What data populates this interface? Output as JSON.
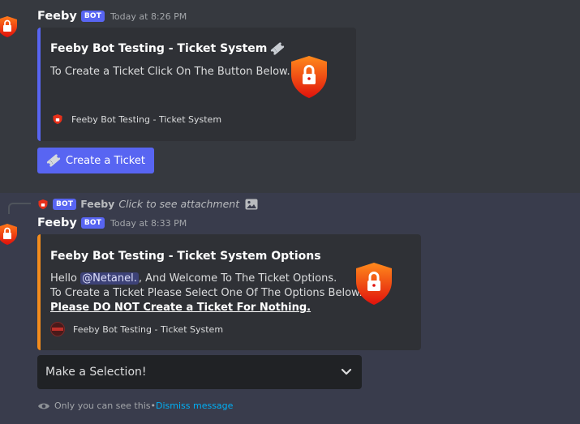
{
  "message1": {
    "username": "Feeby",
    "bot_tag": "BOT",
    "timestamp": "Today at 8:26 PM",
    "embed": {
      "accent_color": "#5865f2",
      "title": "Feeby Bot Testing - Ticket System",
      "description": "To Create a Ticket Click On The Button Below.",
      "footer": "Feeby Bot Testing - Ticket System"
    },
    "button_label": "Create a Ticket"
  },
  "message2": {
    "reply": {
      "bot_tag": "BOT",
      "username": "Feeby",
      "text": "Click to see attachment"
    },
    "username": "Feeby",
    "bot_tag": "BOT",
    "timestamp": "Today at 8:33 PM",
    "embed": {
      "accent_color": "#f48c1c",
      "title": "Feeby Bot Testing - Ticket System Options",
      "line1_prefix": "Hello ",
      "mention": "@Netanel.",
      "line1_suffix": ", And Welcome To The Ticket Options.",
      "line2": "To Create a Ticket Please Select One Of The Options Below.",
      "line3": "Please DO NOT Create a Ticket For Nothing.",
      "footer": "Feeby Bot Testing - Ticket System"
    },
    "select_placeholder": "Make a Selection!",
    "ephemeral": {
      "text": "Only you can see this",
      "separator": " • ",
      "dismiss": "Dismiss message"
    }
  }
}
